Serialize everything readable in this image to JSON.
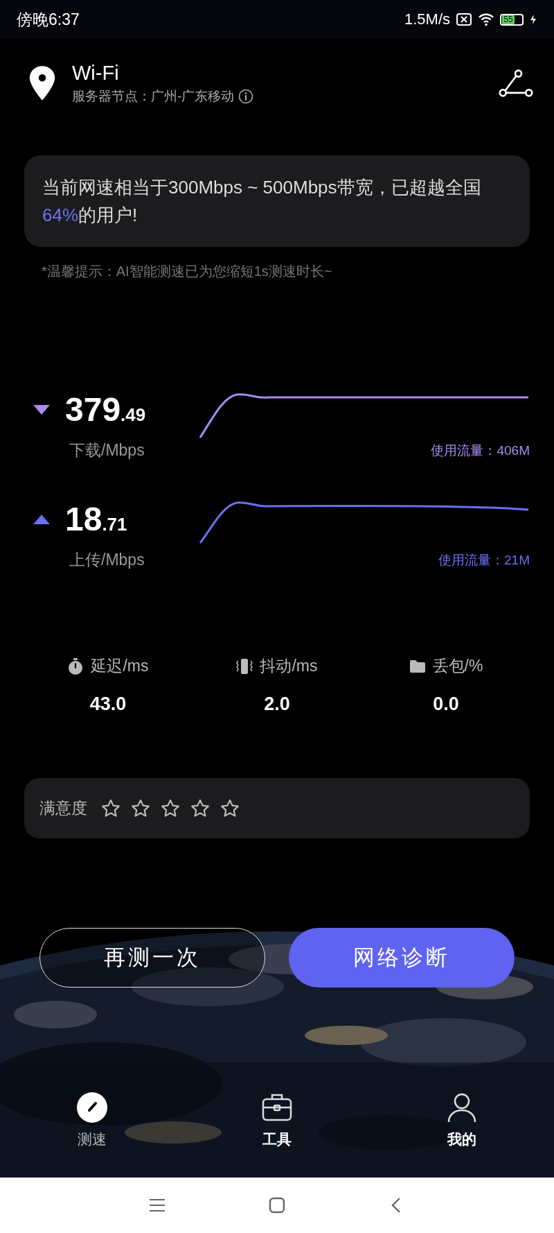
{
  "status_bar": {
    "time": "傍晚6:37",
    "net_speed": "1.5M/s",
    "battery": "55"
  },
  "header": {
    "title": "Wi-Fi",
    "server_label": "服务器节点：",
    "server": "广州-广东移动"
  },
  "banner": {
    "parts": [
      {
        "text": "当前网速相当于300Mbps ~ 500Mbps带宽，已超越全国",
        "highlight": false
      },
      {
        "text": "64%",
        "highlight": true
      },
      {
        "text": "的用户!",
        "highlight": false
      }
    ]
  },
  "tip": "*温馨提示：AI智能测速已为您缩短1s测速时长~",
  "speeds": [
    {
      "kind": "download",
      "value_int": "379",
      "value_dec": ".49",
      "unit": "下载/Mbps",
      "usage": "使用流量：406M",
      "color": "#a98bf0"
    },
    {
      "kind": "upload",
      "value_int": "18",
      "value_dec": ".71",
      "unit": "上传/Mbps",
      "usage": "使用流量：21M",
      "color": "#6b6ff2"
    }
  ],
  "metrics": [
    {
      "kind": "latency",
      "label": "延迟/ms",
      "value": "43.0"
    },
    {
      "kind": "jitter",
      "label": "抖动/ms",
      "value": "2.0"
    },
    {
      "kind": "loss",
      "label": "丢包/%",
      "value": "0.0"
    }
  ],
  "rating": {
    "label": "满意度",
    "stars": 0
  },
  "buttons": [
    {
      "label": "再测一次",
      "kind": "outline"
    },
    {
      "label": "网络诊断",
      "kind": "primary"
    }
  ],
  "tabs": [
    {
      "label": "测速",
      "kind": "gauge",
      "selected": true
    },
    {
      "label": "工具",
      "kind": "toolbox",
      "selected": false
    },
    {
      "label": "我的",
      "kind": "person",
      "selected": false
    }
  ],
  "system_nav": [
    {
      "kind": "menu"
    },
    {
      "kind": "home"
    },
    {
      "kind": "back"
    }
  ]
}
